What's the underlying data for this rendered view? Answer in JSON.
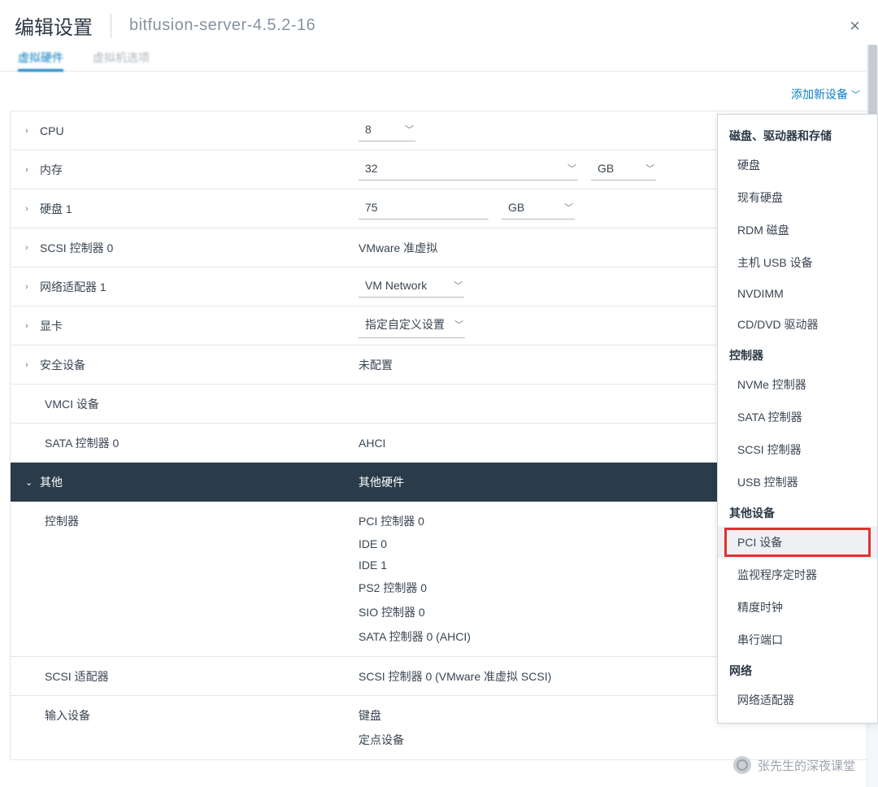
{
  "header": {
    "title": "编辑设置",
    "subtitle": "bitfusion-server-4.5.2-16",
    "close": "×"
  },
  "tabs": {
    "t1": "虚拟硬件",
    "t2": "虚拟机选项"
  },
  "toolbar": {
    "add_device": "添加新设备"
  },
  "rows": {
    "cpu": {
      "label": "CPU",
      "value": "8"
    },
    "mem": {
      "label": "内存",
      "value": "32",
      "unit": "GB"
    },
    "disk1": {
      "label": "硬盘 1",
      "value": "75",
      "unit": "GB"
    },
    "scsi0": {
      "label": "SCSI 控制器 0",
      "value": "VMware 准虚拟"
    },
    "net1": {
      "label": "网络适配器 1",
      "value": "VM Network"
    },
    "gpu": {
      "label": "显卡",
      "value": "指定自定义设置"
    },
    "sec": {
      "label": "安全设备",
      "value": "未配置"
    },
    "vmci": {
      "label": "VMCI 设备"
    },
    "sata0": {
      "label": "SATA 控制器 0",
      "value": "AHCI"
    },
    "other": {
      "label": "其他",
      "value": "其他硬件"
    },
    "controller": {
      "label": "控制器",
      "v0": "PCI 控制器 0",
      "v1": "IDE 0",
      "v2": "IDE 1",
      "v3": "PS2 控制器 0",
      "v4": "SIO 控制器 0",
      "v5": "SATA 控制器 0 (AHCI)"
    },
    "scsi_adapter": {
      "label": "SCSI 适配器",
      "value": "SCSI 控制器 0 (VMware 准虚拟 SCSI)"
    },
    "input": {
      "label": "输入设备",
      "v0": "键盘",
      "v1": "定点设备"
    }
  },
  "dropdown": {
    "s1": "磁盘、驱动器和存储",
    "s1_items": {
      "i0": "硬盘",
      "i1": "现有硬盘",
      "i2": "RDM 磁盘",
      "i3": "主机 USB 设备",
      "i4": "NVDIMM",
      "i5": "CD/DVD 驱动器"
    },
    "s2": "控制器",
    "s2_items": {
      "i0": "NVMe 控制器",
      "i1": "SATA 控制器",
      "i2": "SCSI 控制器",
      "i3": "USB 控制器"
    },
    "s3": "其他设备",
    "s3_items": {
      "i0": "PCI 设备",
      "i1": "监视程序定时器",
      "i2": "精度时钟",
      "i3": "串行端口"
    },
    "s4": "网络",
    "s4_items": {
      "i0": "网络适配器"
    }
  },
  "watermark": "张先生的深夜课堂"
}
